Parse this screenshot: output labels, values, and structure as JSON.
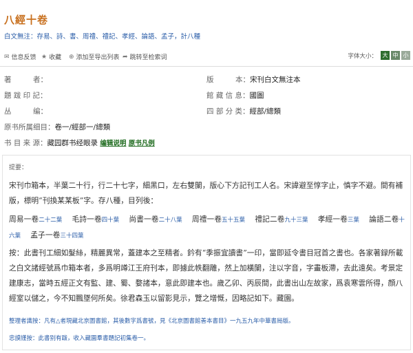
{
  "title": "八經十卷",
  "scope": {
    "label": "白文無注：",
    "text": "存易、詩、書、周禮、禮記、孝經、論語、孟子，計八種"
  },
  "toolbar": {
    "feedback": "信息反馈",
    "favorite": "收藏",
    "export": "添加至导出列表",
    "goto": "跳转至检索词",
    "fontsize_label": "字体大小：",
    "fs_large": "大",
    "fs_medium": "中",
    "fs_small": "小"
  },
  "meta": {
    "author_k": "著　　　者：",
    "author_v": "",
    "edition_k": "版　　　本：",
    "edition_v": "宋刊白文無注本",
    "seal_k": "題 跋 印 記：",
    "seal_v": "",
    "holding_k": "館 藏 信 息：",
    "holding_v": "國圖",
    "series_k": "丛　　　编：",
    "series_v": "",
    "sibu_k": "四 部 分 类：",
    "sibu_v": "經部/總類",
    "orig_k": "原书所属细目：",
    "orig_v": "卷一/經部一/總類",
    "source_k": "书 目 来 源：",
    "source_v": "藏园群书经眼录",
    "source_link1": "编辑说明",
    "source_link2": "原书凡例"
  },
  "abstract": {
    "label": "提要：",
    "p1": "宋刊巾箱本，半葉二十行，行二十七字，細黑口，左右雙闌，版心下方記刊工人名。宋諱避至惇字止，慎字不避。間有補版，標明“刊換某某板”字。存八種，目列後：",
    "books": [
      {
        "name": "周易一卷",
        "leaves": "二十二葉"
      },
      {
        "name": "毛詩一卷",
        "leaves": "四十葉"
      },
      {
        "name": "尚書一卷",
        "leaves": "二十八葉"
      },
      {
        "name": "周禮一卷",
        "leaves": "五十五葉"
      },
      {
        "name": "禮記二卷",
        "leaves": "九十三葉"
      },
      {
        "name": "孝經一卷",
        "leaves": "三葉"
      },
      {
        "name": "論語二卷",
        "leaves": "十六葉"
      },
      {
        "name": "孟子一卷",
        "leaves": "三十四葉"
      }
    ],
    "p3": "按：此書刊工細如髮絲，精麗異常，蓋建本之至精者。鈐有“季振宜讀書”一印，當即延令書目冠首之書也。各家著録所載之白文諸經號爲巾箱本者，多爲明竴江王府刊本，即據此帙翻雕，然上加橫闌，注以字音，字畫板滯，去此遠矣。考景定建康志，當時五經正文有監、建、蜀、婺諸本，意此即建本也。歲乙卯、丙辰間，此書出山左故家，爲袁寒雲所得，顔八經室以儲之，今不知飄墜何所矣。徐君森玉以留影見示，覽之增慨，因略記如下。藏園。",
    "note1": "整理者識按：凡有△者現藏北京圖書館，其後數字爲書號，見《北京圖書館善本書目》一九五九年中華書局版。",
    "note2": "忠謨謹按：此書别有跋，收入藏園羣書題記初集卷一。"
  }
}
